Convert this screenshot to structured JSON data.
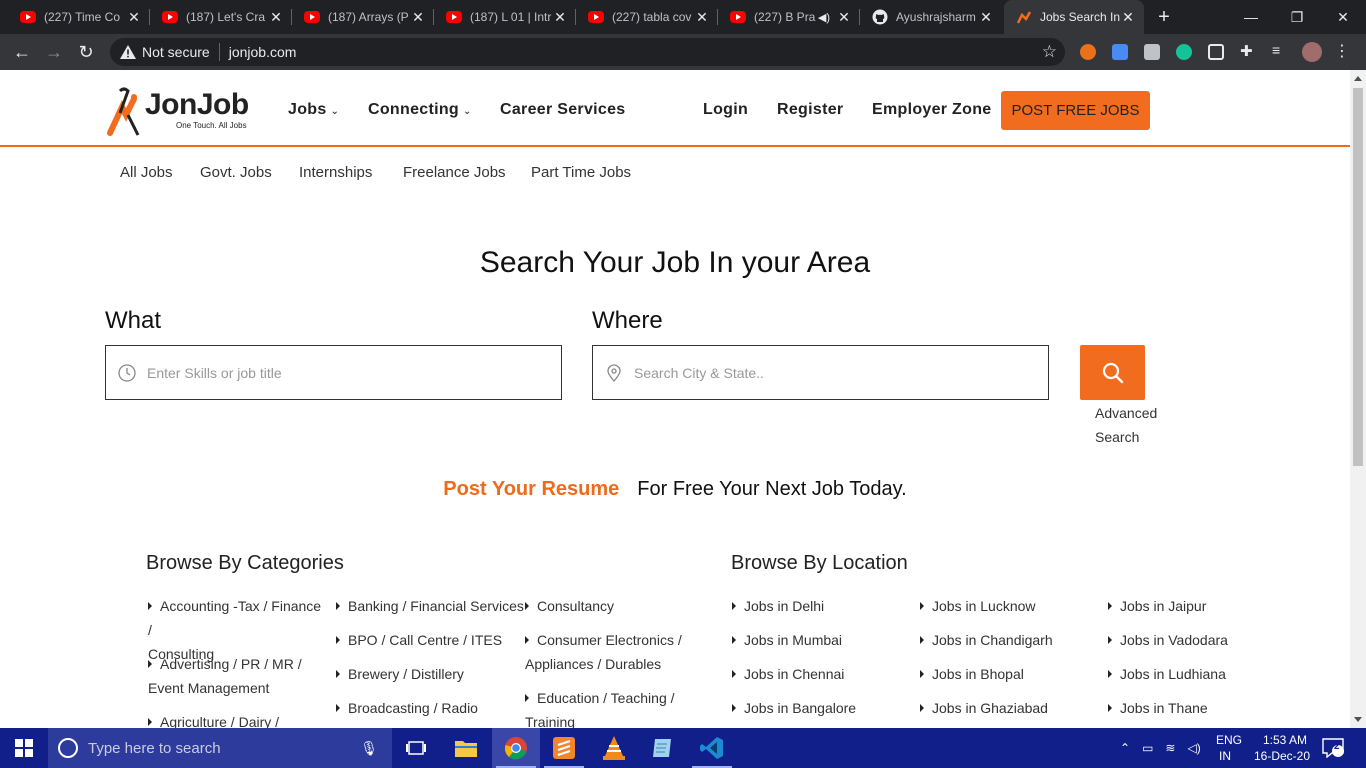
{
  "browser": {
    "tabs": [
      {
        "title": "(227) Time Co",
        "icon": "youtube-icon"
      },
      {
        "title": "(187) Let's Cra",
        "icon": "youtube-icon"
      },
      {
        "title": "(187) Arrays (P",
        "icon": "youtube-icon"
      },
      {
        "title": "(187) L 01 | Intr",
        "icon": "youtube-icon"
      },
      {
        "title": "(227) tabla cov",
        "icon": "youtube-icon"
      },
      {
        "title": "(227) B Pra",
        "icon": "youtube-icon"
      },
      {
        "title": "Ayushrajsharm",
        "icon": "github-icon"
      },
      {
        "title": "Jobs Search In",
        "icon": "jonjob-icon"
      }
    ],
    "security_label": "Not secure",
    "url": "jonjob.com"
  },
  "header": {
    "logo_name": "JonJob",
    "logo_tagline": "One Touch. All Jobs",
    "nav": {
      "jobs": "Jobs",
      "connecting": "Connecting",
      "career": "Career Services",
      "login": "Login",
      "register": "Register",
      "employer": "Employer Zone"
    },
    "post_button": "POST FREE JOBS"
  },
  "subnav": [
    "All Jobs",
    "Govt. Jobs",
    "Internships",
    "Freelance Jobs",
    "Part Time Jobs"
  ],
  "search": {
    "headline": "Search Your Job In your Area",
    "what_label": "What",
    "what_placeholder": "Enter Skills or job title",
    "where_label": "Where",
    "where_placeholder": "Search City & State..",
    "advanced_1": "Advanced",
    "advanced_2": "Search"
  },
  "resume": {
    "highlight": "Post Your Resume",
    "text": "For Free Your Next Job Today."
  },
  "categories": {
    "title": "Browse By Categories",
    "col1": [
      [
        "Accounting -Tax / Finance /",
        "Consulting"
      ],
      [
        "Advertising / PR / MR /",
        "Event Management"
      ],
      [
        "Agriculture / Dairy /"
      ]
    ],
    "col2": [
      "Banking / Financial Services",
      "BPO / Call Centre / ITES",
      "Brewery / Distillery",
      "Broadcasting / Radio"
    ],
    "col3": [
      [
        "Consultancy"
      ],
      [
        "Consumer Electronics /",
        "Appliances / Durables"
      ],
      [
        "Education / Teaching /",
        "Training"
      ]
    ]
  },
  "locations": {
    "title": "Browse By Location",
    "col1": [
      "Jobs in Delhi",
      "Jobs in Mumbai",
      "Jobs in Chennai",
      "Jobs in Bangalore"
    ],
    "col2": [
      "Jobs in Lucknow",
      "Jobs in Chandigarh",
      "Jobs in Bhopal",
      "Jobs in Ghaziabad"
    ],
    "col3": [
      "Jobs in Jaipur",
      "Jobs in Vadodara",
      "Jobs in Ludhiana",
      "Jobs in Thane"
    ]
  },
  "taskbar": {
    "search_placeholder": "Type here to search",
    "lang_1": "ENG",
    "lang_2": "IN",
    "time": "1:53 AM",
    "date": "16-Dec-20",
    "notifications": "2"
  },
  "colors": {
    "accent": "#f26c1f",
    "taskbar": "#101f8a"
  }
}
